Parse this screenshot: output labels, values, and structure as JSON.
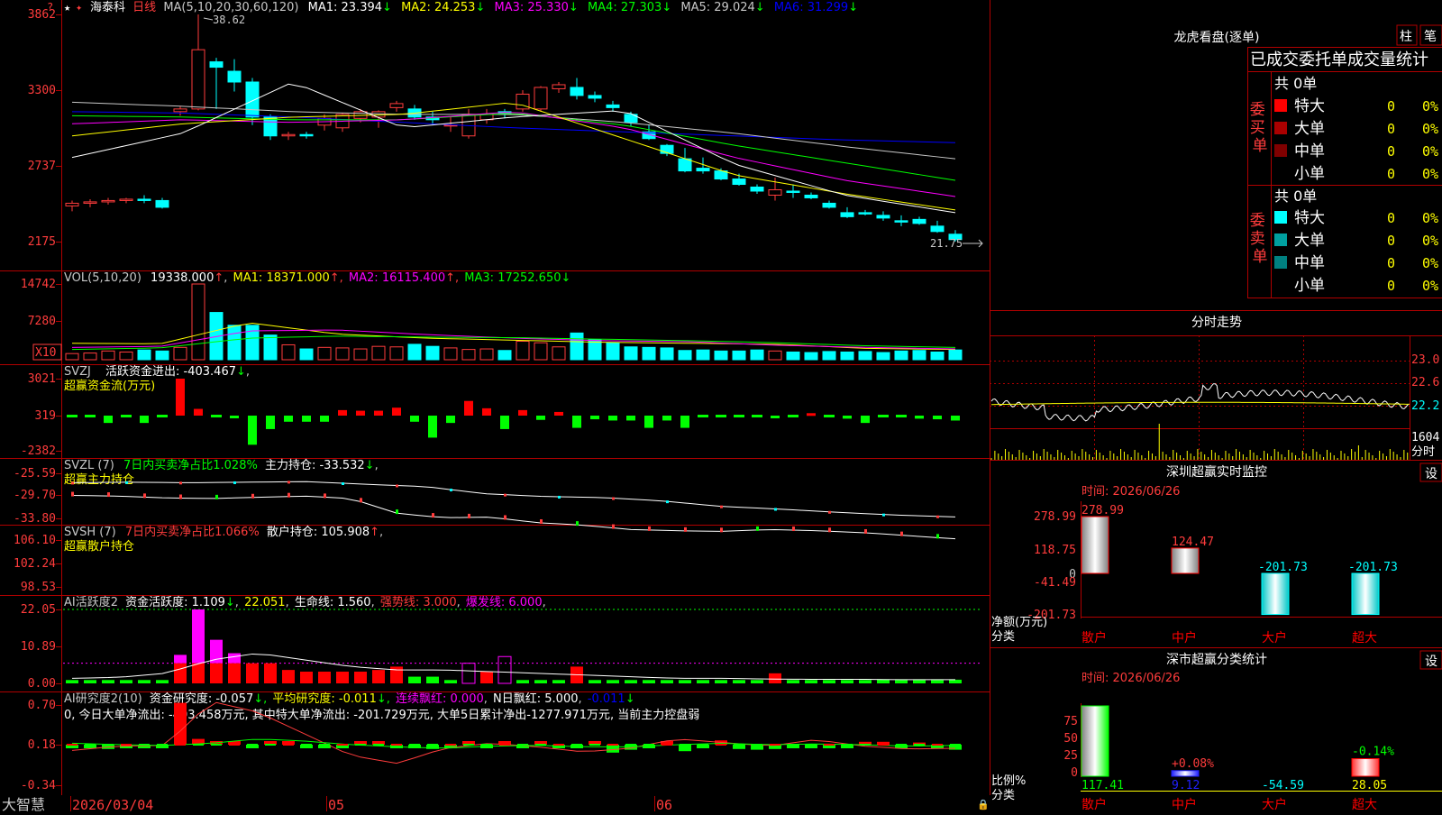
{
  "header": {
    "stock_name": "海泰科",
    "period": "日线",
    "ma_label": "MA(5,10,20,30,60,120)",
    "ma": [
      {
        "label": "MA1: 23.394",
        "arrow": "↓",
        "color": "#ffffff"
      },
      {
        "label": "MA2: 24.253",
        "arrow": "↓",
        "color": "#ffff00"
      },
      {
        "label": "MA3: 25.330",
        "arrow": "↓",
        "color": "#ff00ff"
      },
      {
        "label": "MA4: 27.303",
        "arrow": "↓",
        "color": "#00ff00"
      },
      {
        "label": "MA5: 29.024",
        "arrow": "↓",
        "color": "#c8c8c8"
      },
      {
        "label": "MA6: 31.299",
        "arrow": "↓",
        "color": "#0000ff"
      }
    ],
    "high_label": "38.62",
    "low_label": "21.75"
  },
  "price_axis": [
    "3862",
    "3300",
    "2737",
    "2175"
  ],
  "vol": {
    "label": "VOL(5,10,20)",
    "value": "19338.000",
    "arrow": "↑",
    "items": [
      {
        "label": "MA1: 18371.000",
        "arrow": "↑",
        "color": "#ffff00"
      },
      {
        "label": "MA2: 16115.400",
        "arrow": "↑",
        "color": "#ff00ff"
      },
      {
        "label": "MA3: 17252.650",
        "arrow": "↓",
        "color": "#00ff00"
      }
    ],
    "axis": [
      "14742",
      "7280"
    ],
    "unit": "X10"
  },
  "svzj": {
    "label": "SVZJ",
    "text": "活跃资金进出: -403.467",
    "arrow": "↓",
    "subtitle": "超赢资金流(万元)",
    "axis": [
      "3021",
      "319",
      "-2382"
    ]
  },
  "svzl": {
    "label": "SVZL (7)",
    "ratio": "7日内买卖净占比1.028%",
    "main": "主力持仓: -33.532",
    "arrow": "↓",
    "subtitle": "超赢主力持仓",
    "axis": [
      "-25.59",
      "-29.70",
      "-33.80"
    ]
  },
  "svsh": {
    "label": "SVSH (7)",
    "ratio": "7日内买卖净占比1.066%",
    "main": "散户持仓: 105.908",
    "arrow": "↑",
    "subtitle": "超赢散户持仓",
    "axis": [
      "106.10",
      "102.24",
      "98.53"
    ]
  },
  "ai_active": {
    "label": "AI活跃度2",
    "fund": "资金活跃度: 1.109",
    "fund_arrow": "↓",
    "v2": "22.051",
    "life": "生命线: 1.560",
    "strong": "强势线: 3.000",
    "burst": "爆发线: 6.000",
    "axis": [
      "22.05",
      "10.89",
      "0.00"
    ]
  },
  "ai_research": {
    "label": "AI研究度2(10)",
    "fund": "资金研究度: -0.057",
    "avg": "平均研究度: -0.011",
    "red": "连续飘红: 0.000",
    "nred": "N日飘红: 5.000",
    "neg": "-0.011",
    "comment": "0, 今日大单净流出: -403.458万元, 其中特大单净流出: -201.729万元, 大单5日累计净出-1277.971万元, 当前主力控盘弱",
    "axis": [
      "0.70",
      "0.18",
      "-0.34"
    ]
  },
  "bottom_bar": {
    "brand": "大智慧",
    "date_start": "2026/03/04",
    "month_05": "05",
    "month_06": "06"
  },
  "right_panel": {
    "btn_zhu": "柱",
    "btn_bi": "笔",
    "title": "龙虎看盘(逐单)",
    "subtitle": "已成交委托单成交量统计",
    "buy_label": "委买单",
    "sell_label": "委卖单",
    "buy_total": "共 0单",
    "sell_total": "共 0单",
    "buy_rows": [
      {
        "name": "特大",
        "qty": "0",
        "pct": "0%",
        "color": "#ff0000"
      },
      {
        "name": "大单",
        "qty": "0",
        "pct": "0%",
        "color": "#aa0000"
      },
      {
        "name": "中单",
        "qty": "0",
        "pct": "0%",
        "color": "#800000"
      },
      {
        "name": "小单",
        "qty": "0",
        "pct": "0%",
        "color": "#000000"
      }
    ],
    "sell_rows": [
      {
        "name": "特大",
        "qty": "0",
        "pct": "0%",
        "color": "#00ffff"
      },
      {
        "name": "大单",
        "qty": "0",
        "pct": "0%",
        "color": "#00a0a0"
      },
      {
        "name": "中单",
        "qty": "0",
        "pct": "0%",
        "color": "#008080"
      },
      {
        "name": "小单",
        "qty": "0",
        "pct": "0%",
        "color": "#000000"
      }
    ],
    "intraday_title": "分时走势",
    "intraday_axis": [
      "23.0",
      "22.6",
      "22.2"
    ],
    "intraday_vol": "1604",
    "intraday_unit": "分时",
    "monitor_title": "深圳超赢实时监控",
    "monitor_btn": "设",
    "monitor_time": "时间: 2026/06/26",
    "monitor_axis": [
      "278.99",
      "118.75",
      "0",
      "-41.49",
      "-201.73"
    ],
    "monitor_unit_1": "净额(万元)",
    "monitor_unit_2": "分类",
    "monitor_bars": [
      {
        "cat": "散户",
        "value": 278.99,
        "label": "278.99"
      },
      {
        "cat": "中户",
        "value": 124.47,
        "label": "124.47"
      },
      {
        "cat": "大户",
        "value": -201.73,
        "label": "-201.73"
      },
      {
        "cat": "超大",
        "value": -201.73,
        "label": "-201.73"
      }
    ],
    "class_title": "深市超赢分类统计",
    "class_btn": "设",
    "class_time": "时间: 2026/06/26",
    "class_axis": [
      "75",
      "50",
      "25",
      "0"
    ],
    "class_unit_1": "比例%",
    "class_unit_2": "分类",
    "class_bars": [
      {
        "cat": "散户",
        "bottom": "117.41",
        "top": "",
        "pct": 100
      },
      {
        "cat": "中户",
        "bottom": "9.12",
        "top": "+0.08%",
        "pct": 8
      },
      {
        "cat": "大户",
        "bottom": "-54.59",
        "top": "",
        "pct": 0
      },
      {
        "cat": "超大",
        "bottom": "28.05",
        "top": "-0.14%",
        "pct": 25
      }
    ]
  }
}
